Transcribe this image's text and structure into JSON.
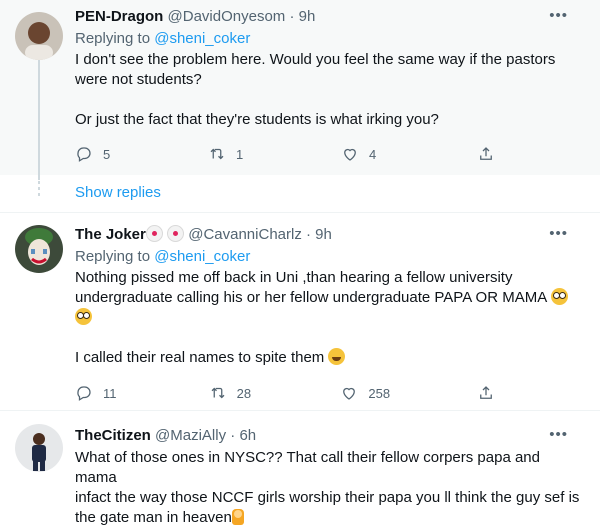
{
  "tweets": [
    {
      "name": "PEN-Dragon",
      "handle": "@DavidOnyesom",
      "time": "9h",
      "replying_prefix": "Replying to",
      "replying_to": "@sheni_coker",
      "text_1": "I don't see the problem here. Would you feel the same way if the pastors",
      "text_2": "were not students?",
      "text_3": "Or just the fact that they're students is what irking you?",
      "replies": "5",
      "retweets": "1",
      "likes": "4"
    },
    {
      "name": "The Joker",
      "handle": "@CavanniCharlz",
      "time": "9h",
      "replying_prefix": "Replying to",
      "replying_to": "@sheni_coker",
      "text_1": "Nothing pissed me off back in Uni  ,than hearing a fellow university",
      "text_2": "undergraduate  calling his or her fellow undergraduate PAPA OR MAMA",
      "text_3": "I called their real names to spite them",
      "replies": "11",
      "retweets": "28",
      "likes": "258"
    },
    {
      "name": "TheCitizen",
      "handle": "@MaziAlly",
      "time": "6h",
      "text_1": "What of those ones in NYSC?? That call their fellow corpers papa and mama",
      "text_2": "infact the way those NCCF girls worship their papa you ll think the guy sef is",
      "text_3": "the gate man in heaven"
    }
  ],
  "show_replies": "Show replies",
  "separator": "·",
  "colors": {
    "link": "#1d9bf0",
    "muted": "#536471",
    "highlight_bg": "#f7f9f9"
  },
  "icons": [
    "reply-icon",
    "retweet-icon",
    "like-icon",
    "share-icon",
    "more-icon",
    "flushed-emoji",
    "laughing-emoji",
    "clown-emoji",
    "person-emoji"
  ]
}
